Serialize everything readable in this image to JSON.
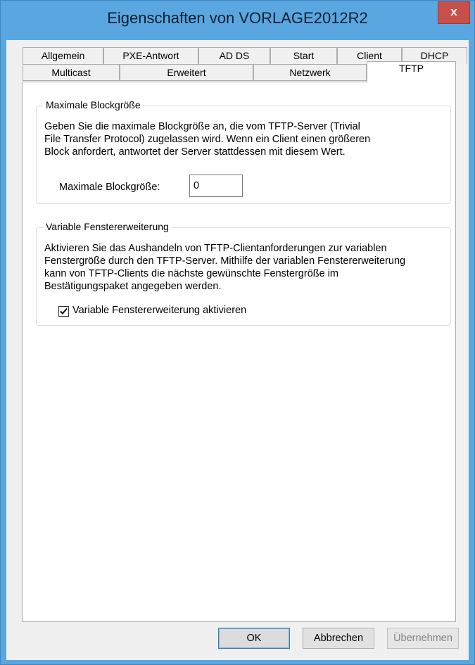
{
  "window": {
    "title": "Eigenschaften von VORLAGE2012R2",
    "close_label": "x"
  },
  "tabs": {
    "row1": [
      "Allgemein",
      "PXE-Antwort",
      "AD DS",
      "Start",
      "Client",
      "DHCP"
    ],
    "row2": [
      "Multicast",
      "Erweitert",
      "Netzwerk",
      "TFTP"
    ],
    "active": "TFTP"
  },
  "block_size": {
    "group_title": "Maximale Blockgröße",
    "description_lines": [
      "Geben Sie die maximale Blockgröße an, die vom TFTP-Server (Trivial",
      "File Transfer Protocol) zugelassen wird. Wenn ein Client einen größeren",
      "Block anfordert, antwortet der Server stattdessen mit diesem Wert."
    ],
    "field_label": "Maximale Blockgröße:",
    "field_value": "0"
  },
  "window_extension": {
    "group_title": "Variable Fenstererweiterung",
    "description_lines": [
      "Aktivieren Sie das Aushandeln von TFTP-Clientanforderungen zur variablen",
      "Fenstergröße durch den TFTP-Server. Mithilfe der variablen Fenstererweiterung",
      "kann von TFTP-Clients die nächste gewünschte Fenstergröße im",
      "Bestätigungspaket angegeben werden."
    ],
    "checkbox_label": "Variable Fenstererweiterung aktivieren",
    "checkbox_checked": true
  },
  "buttons": {
    "ok": "OK",
    "cancel": "Abbrechen",
    "apply": "Übernehmen"
  },
  "colors": {
    "titlebar": "#5aa6e0",
    "close_button": "#c7504a",
    "dialog_bg": "#f0f0f0"
  }
}
